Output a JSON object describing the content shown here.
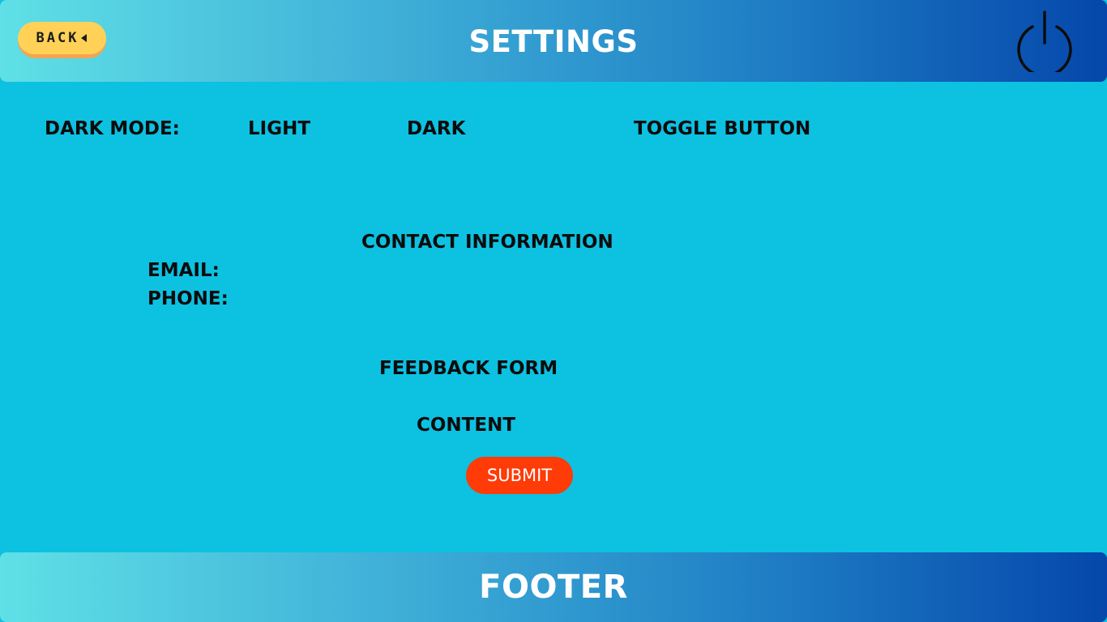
{
  "header": {
    "title": "SETTINGS",
    "back_label": "BACK",
    "back_icon": "caret-left-icon",
    "power_icon": "power-icon"
  },
  "settings": {
    "dark_mode_label": "DARK MODE:",
    "light_option": "LIGHT",
    "dark_option": "DARK",
    "toggle_label": "TOGGLE BUTTON"
  },
  "contact": {
    "heading": "CONTACT INFORMATION",
    "email_label": "EMAIL:",
    "phone_label": "PHONE:"
  },
  "feedback": {
    "heading": "FEEDBACK FORM",
    "content_label": "CONTENT",
    "submit_label": "SUBMIT"
  },
  "footer": {
    "title": "FOOTER"
  },
  "colors": {
    "background": "#0dc1e1",
    "gradient_start": "#5fe0e6",
    "gradient_end": "#0547ab",
    "back_button": "#ffd257",
    "submit_button": "#ff3b07"
  }
}
